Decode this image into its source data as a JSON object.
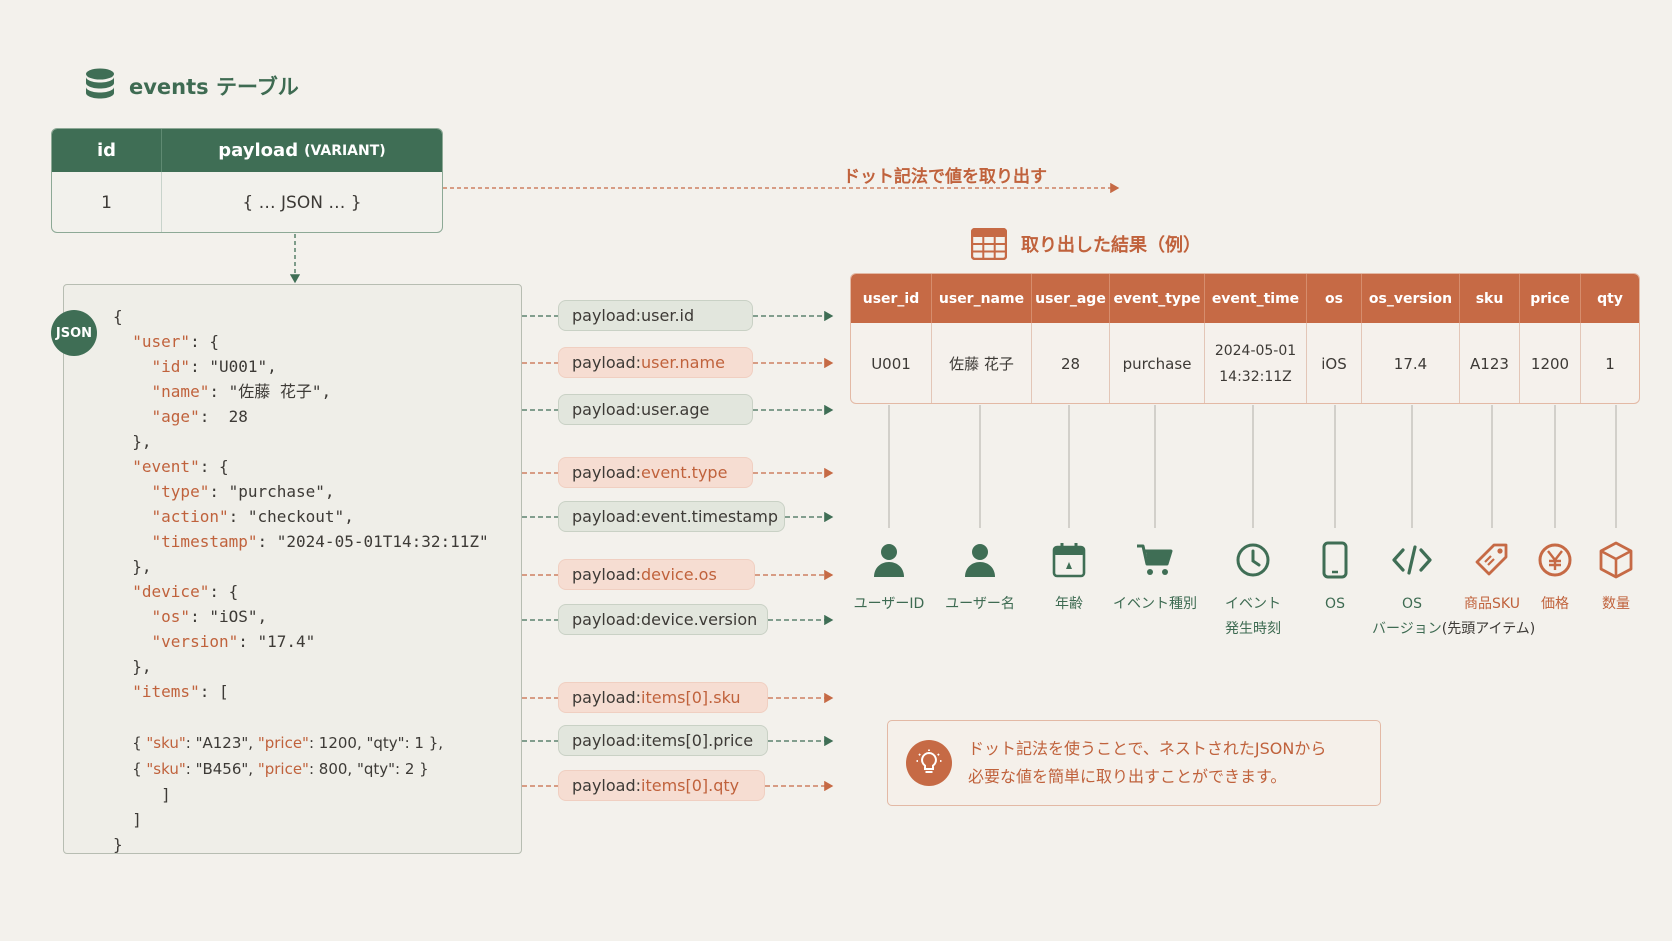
{
  "header": {
    "title": "events テーブル",
    "icon": "database-icon"
  },
  "events_table": {
    "col_id": "id",
    "col_payload": "payload",
    "col_payload_type": "(VARIANT)",
    "row_id": "1",
    "row_payload": "{ … JSON … }"
  },
  "dot_notation_label": "ドット記法で値を取り出す",
  "json_badge": "JSON",
  "json_lines": {
    "l1": "{",
    "l2a": "\"user\"",
    "l2b": ": {",
    "l3a": "\"id\"",
    "l3b": ": \"U001\",",
    "l4a": "\"name\"",
    "l4b": ": \"佐藤 花子\",",
    "l5a": "\"age\"",
    "l5b": ":  28",
    "l6": "},",
    "l7a": "\"event\"",
    "l7b": ": {",
    "l8a": "\"type\"",
    "l8b": ": \"purchase\",",
    "l9a": "\"action\"",
    "l9b": ": \"checkout\",",
    "l10a": "\"timestamp\"",
    "l10b": ": \"2024-05-01T14:32:11Z\"",
    "l11": "},",
    "l12a": "\"device\"",
    "l12b": ": {",
    "l13a": "\"os\"",
    "l13b": ": \"iOS\",",
    "l14a": "\"version\"",
    "l14b": ": \"17.4\"",
    "l15": "},",
    "l16a": "\"items\"",
    "l16b": ": [",
    "l17a": "{ ",
    "l17b": "\"sku\"",
    "l17c": ": \"A123\", ",
    "l17d": "\"price\"",
    "l17e": ": 1200, \"qty\": 1 },",
    "l18a": "{ ",
    "l18b": "\"sku\"",
    "l18c": ": \"B456\", ",
    "l18d": "\"price\"",
    "l18e": ": 800, \"qty\": 2 }",
    "l19": "]",
    "l20": "]",
    "l21": "}"
  },
  "pills": [
    {
      "prefix": "payload:",
      "suffix": "user.id",
      "style": "green"
    },
    {
      "prefix": "payload:",
      "suffix": "user.name",
      "style": "orange"
    },
    {
      "prefix": "payload:",
      "suffix": "user.age",
      "style": "green"
    },
    {
      "prefix": "payload:",
      "suffix": "event.type",
      "style": "orange"
    },
    {
      "prefix": "payload:",
      "suffix": "event.timestamp",
      "style": "green"
    },
    {
      "prefix": "payload:",
      "suffix": "device.os",
      "style": "orange"
    },
    {
      "prefix": "payload:",
      "suffix": "device.version",
      "style": "green"
    },
    {
      "prefix": "payload:",
      "suffix": "items[0].sku",
      "style": "orange"
    },
    {
      "prefix": "payload:",
      "suffix": "items[0].price",
      "style": "green"
    },
    {
      "prefix": "payload:",
      "suffix": "items[0].qty",
      "style": "orange"
    }
  ],
  "result": {
    "title": "取り出した結果（例）",
    "icon": "table-icon",
    "headers": [
      "user_id",
      "user_name",
      "user_age",
      "event_type",
      "event_time",
      "os",
      "os_version",
      "sku",
      "price",
      "qty"
    ],
    "row": [
      "U001",
      "佐藤 花子",
      "28",
      "purchase",
      "2024-05-01 14:32:11Z",
      "iOS",
      "17.4",
      "A123",
      "1200",
      "1"
    ],
    "event_time_line1": "2024-05-01",
    "event_time_line2": "14:32:11Z"
  },
  "icons": [
    {
      "name": "user-icon",
      "label": "ユーザーID",
      "color": "green"
    },
    {
      "name": "user-icon",
      "label": "ユーザー名",
      "color": "green"
    },
    {
      "name": "calendar-icon",
      "label": "年齢",
      "color": "green"
    },
    {
      "name": "cart-icon",
      "label": "イベント種別",
      "color": "green"
    },
    {
      "name": "clock-icon",
      "label": "イベント",
      "label2": "発生時刻",
      "color": "green"
    },
    {
      "name": "phone-icon",
      "label": "OS",
      "color": "green"
    },
    {
      "name": "code-icon",
      "label": "OS",
      "label2": "バージョン",
      "color": "green"
    },
    {
      "name": "tag-icon",
      "label": "商品SKU",
      "label2": "(先頭アイテム)",
      "color": "orange"
    },
    {
      "name": "yen-icon",
      "label": "価格",
      "color": "orange"
    },
    {
      "name": "box-icon",
      "label": "数量",
      "color": "orange"
    }
  ],
  "note": {
    "line1": "ドット記法を使うことで、ネストされたJSONから",
    "line2": "必要な値を簡単に取り出すことができます。",
    "icon": "lightbulb-icon"
  },
  "colors": {
    "green": "#3f6e55",
    "orange": "#c66a45",
    "background": "#f3f1ec"
  }
}
